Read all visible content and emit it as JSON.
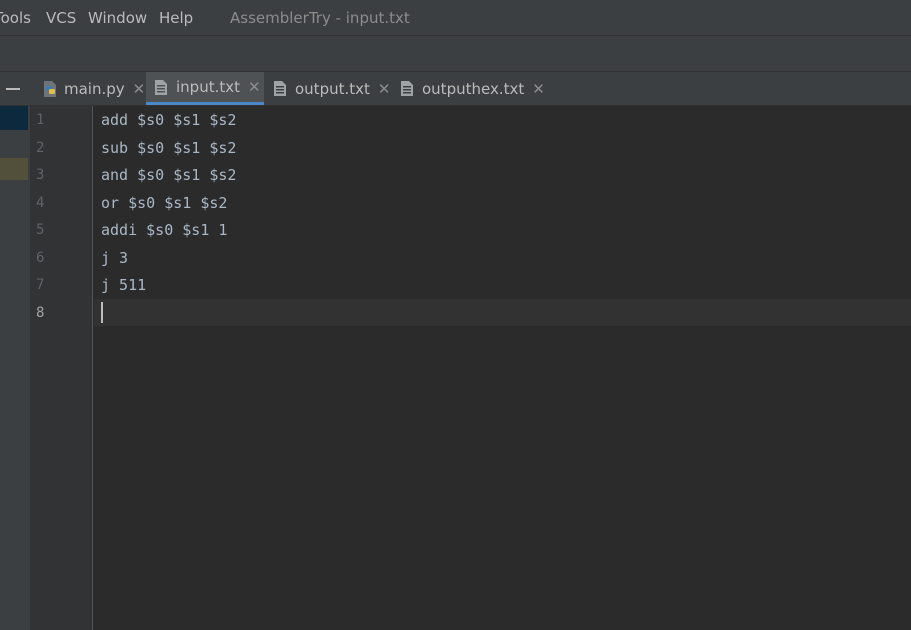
{
  "menubar": {
    "items": [
      {
        "label": "Tools",
        "shown": "Tools"
      },
      {
        "label": "VCS"
      },
      {
        "label": "Window"
      },
      {
        "label": "Help"
      }
    ],
    "window_title": "AssemblerTry - input.txt"
  },
  "tabs": [
    {
      "label": "main.py",
      "icon": "python-file-icon",
      "active": false
    },
    {
      "label": "input.txt",
      "icon": "text-file-icon",
      "active": true
    },
    {
      "label": "output.txt",
      "icon": "text-file-icon",
      "active": false
    },
    {
      "label": "outputhex.txt",
      "icon": "text-file-icon",
      "active": false
    }
  ],
  "tab_close_glyph": "✕",
  "editor": {
    "lines": [
      "add $s0 $s1 $s2",
      "sub $s0 $s1 $s2",
      "and $s0 $s1 $s2",
      "or $s0 $s1 $s2",
      "addi $s0 $s1 1",
      "j 3",
      "j 511",
      ""
    ],
    "line_numbers": [
      "1",
      "2",
      "3",
      "4",
      "5",
      "6",
      "7",
      "8"
    ],
    "current_line": 8
  },
  "colors": {
    "background": "#2b2b2b",
    "panel": "#3c3f41",
    "code_text": "#a9b7c6",
    "active_tab_underline": "#4a88c7"
  }
}
